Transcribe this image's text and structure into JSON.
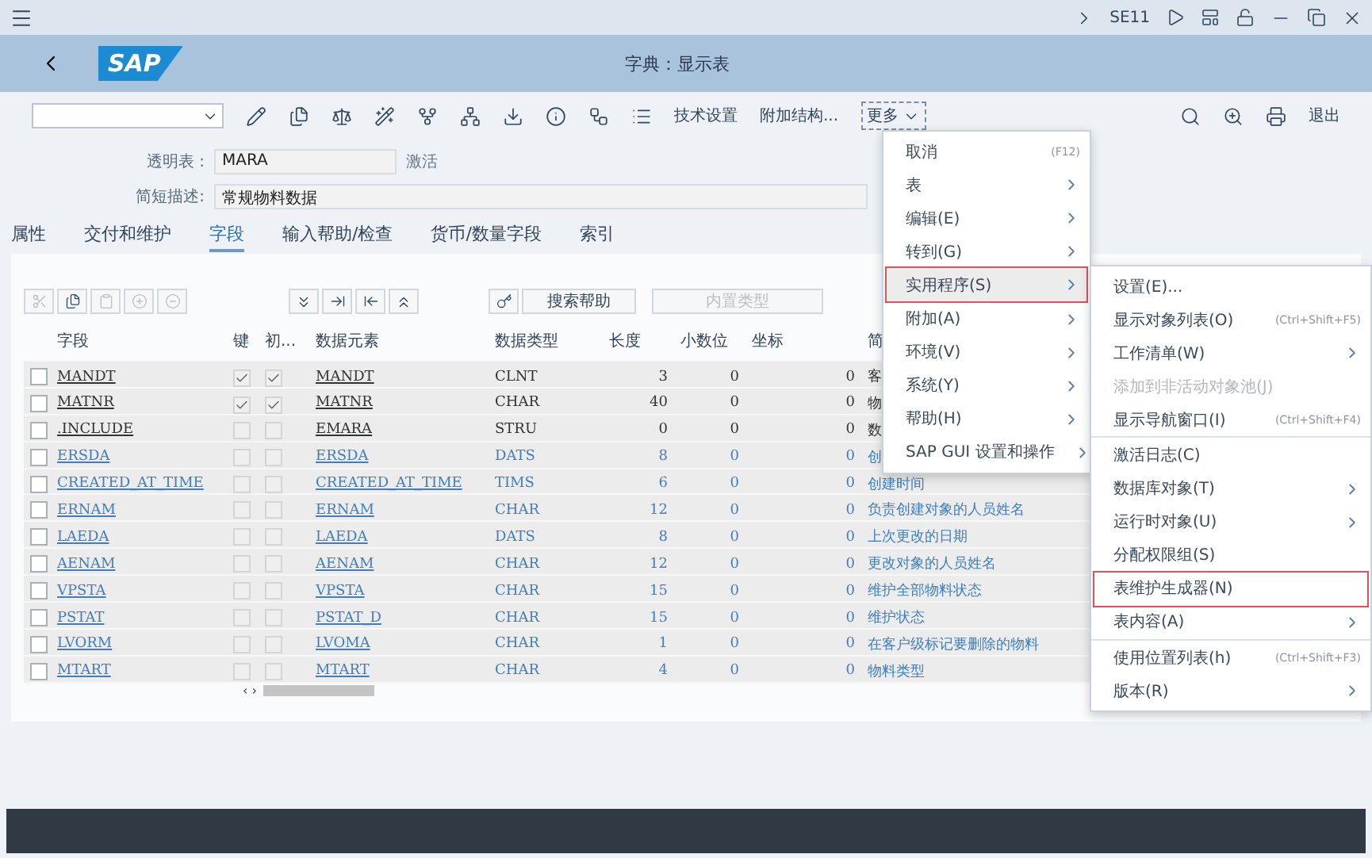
{
  "top_bar": {
    "transaction": "SE11"
  },
  "header": {
    "logo": "SAP",
    "title": "字典：显示表"
  },
  "toolbar": {
    "buttons": [
      "技术设置",
      "附加结构..."
    ],
    "more": "更多",
    "exit": "退出"
  },
  "form": {
    "table_label": "透明表 :",
    "table_value": "MARA",
    "status": "激活",
    "desc_label": "简短描述:",
    "desc_value": "常规物料数据"
  },
  "tabs": [
    {
      "label": "属性",
      "selected": false
    },
    {
      "label": "交付和维护",
      "selected": false
    },
    {
      "label": "字段",
      "selected": true
    },
    {
      "label": "输入帮助/检查",
      "selected": false
    },
    {
      "label": "货币/数量字段",
      "selected": false
    },
    {
      "label": "索引",
      "selected": false
    }
  ],
  "table_toolbar": {
    "search_help": "搜索帮助",
    "builtin_type": "内置类型"
  },
  "table": {
    "scroll_arrows": "‹ ›",
    "columns": [
      "字段",
      "键",
      "初...",
      "数据元素",
      "数据类型",
      "长度",
      "小数位",
      "坐标",
      "简"
    ],
    "rows": [
      {
        "kind": "plain",
        "checked": false,
        "field": "MANDT",
        "key": true,
        "initial": true,
        "data_element": "MANDT",
        "data_type": "CLNT",
        "length": "3",
        "decimals": "0",
        "coordinate": "0",
        "description": "客"
      },
      {
        "kind": "plain",
        "checked": false,
        "field": "MATNR",
        "key": true,
        "initial": true,
        "data_element": "MATNR",
        "data_type": "CHAR",
        "length": "40",
        "decimals": "0",
        "coordinate": "0",
        "description": "物"
      },
      {
        "kind": "plain",
        "checked": false,
        "field": ".INCLUDE",
        "key": false,
        "initial": false,
        "data_element": "EMARA",
        "data_type": "STRU",
        "length": "0",
        "decimals": "0",
        "coordinate": "0",
        "description": "数"
      },
      {
        "kind": "link",
        "checked": false,
        "field": "ERSDA",
        "key": false,
        "initial": false,
        "data_element": "ERSDA",
        "data_type": "DATS",
        "length": "8",
        "decimals": "0",
        "coordinate": "0",
        "description": "创"
      },
      {
        "kind": "link",
        "checked": false,
        "field": "CREATED_AT_TIME",
        "key": false,
        "initial": false,
        "data_element": "CREATED_AT_TIME",
        "data_type": "TIMS",
        "length": "6",
        "decimals": "0",
        "coordinate": "0",
        "description": "创建时间"
      },
      {
        "kind": "link",
        "checked": false,
        "field": "ERNAM",
        "key": false,
        "initial": false,
        "data_element": "ERNAM",
        "data_type": "CHAR",
        "length": "12",
        "decimals": "0",
        "coordinate": "0",
        "description": "负责创建对象的人员姓名"
      },
      {
        "kind": "link",
        "checked": false,
        "field": "LAEDA",
        "key": false,
        "initial": false,
        "data_element": "LAEDA",
        "data_type": "DATS",
        "length": "8",
        "decimals": "0",
        "coordinate": "0",
        "description": "上次更改的日期"
      },
      {
        "kind": "link",
        "checked": false,
        "field": "AENAM",
        "key": false,
        "initial": false,
        "data_element": "AENAM",
        "data_type": "CHAR",
        "length": "12",
        "decimals": "0",
        "coordinate": "0",
        "description": "更改对象的人员姓名"
      },
      {
        "kind": "link",
        "checked": false,
        "field": "VPSTA",
        "key": false,
        "initial": false,
        "data_element": "VPSTA",
        "data_type": "CHAR",
        "length": "15",
        "decimals": "0",
        "coordinate": "0",
        "description": "维护全部物料状态"
      },
      {
        "kind": "link",
        "checked": false,
        "field": "PSTAT",
        "key": false,
        "initial": false,
        "data_element": "PSTAT_D",
        "data_type": "CHAR",
        "length": "15",
        "decimals": "0",
        "coordinate": "0",
        "description": "维护状态"
      },
      {
        "kind": "link",
        "checked": false,
        "field": "LVORM",
        "key": false,
        "initial": false,
        "data_element": "LVOMA",
        "data_type": "CHAR",
        "length": "1",
        "decimals": "0",
        "coordinate": "0",
        "description": "在客户级标记要删除的物料"
      },
      {
        "kind": "link",
        "checked": false,
        "field": "MTART",
        "key": false,
        "initial": false,
        "data_element": "MTART",
        "data_type": "CHAR",
        "length": "4",
        "decimals": "0",
        "coordinate": "0",
        "description": "物料类型"
      }
    ]
  },
  "menu": {
    "groups": [
      [
        {
          "label": "取消",
          "shortcut": "(F12)",
          "submenu": false,
          "disabled": false,
          "selected": false,
          "highlighted": false
        },
        {
          "label": "表",
          "submenu": true,
          "disabled": false,
          "selected": false,
          "highlighted": false
        },
        {
          "label": "编辑(E)",
          "submenu": true,
          "disabled": false,
          "selected": false,
          "highlighted": false
        },
        {
          "label": "转到(G)",
          "submenu": true,
          "disabled": false,
          "selected": false,
          "highlighted": false
        },
        {
          "label": "实用程序(S)",
          "submenu": true,
          "disabled": false,
          "selected": true,
          "highlighted": true
        },
        {
          "label": "附加(A)",
          "submenu": true,
          "disabled": false,
          "selected": false,
          "highlighted": false
        },
        {
          "label": "环境(V)",
          "submenu": true,
          "disabled": false,
          "selected": false,
          "highlighted": false
        },
        {
          "label": "系统(Y)",
          "submenu": true,
          "disabled": false,
          "selected": false,
          "highlighted": false
        },
        {
          "label": "帮助(H)",
          "submenu": true,
          "disabled": false,
          "selected": false,
          "highlighted": false
        },
        {
          "label": "SAP GUI 设置和操作",
          "submenu": true,
          "disabled": false,
          "selected": false,
          "highlighted": false
        }
      ]
    ]
  },
  "submenu": {
    "groups": [
      [
        {
          "label": "设置(E)...",
          "submenu": false,
          "disabled": false,
          "selected": false,
          "highlighted": false
        },
        {
          "label": "显示对象列表(O)",
          "shortcut": "(Ctrl+Shift+F5)",
          "submenu": false,
          "disabled": false,
          "selected": false,
          "highlighted": false
        },
        {
          "label": "工作清单(W)",
          "submenu": true,
          "disabled": false,
          "selected": false,
          "highlighted": false
        },
        {
          "label": "添加到非活动对象池(J)",
          "submenu": false,
          "disabled": true,
          "selected": false,
          "highlighted": false
        },
        {
          "label": "显示导航窗口(I)",
          "shortcut": "(Ctrl+Shift+F4)",
          "submenu": false,
          "disabled": false,
          "selected": false,
          "highlighted": false
        }
      ],
      [
        {
          "label": "激活日志(C)",
          "submenu": false,
          "disabled": false,
          "selected": false,
          "highlighted": false
        },
        {
          "label": "数据库对象(T)",
          "submenu": true,
          "disabled": false,
          "selected": false,
          "highlighted": false
        },
        {
          "label": "运行时对象(U)",
          "submenu": true,
          "disabled": false,
          "selected": false,
          "highlighted": false
        },
        {
          "label": "分配权限组(S)",
          "submenu": false,
          "disabled": false,
          "selected": false,
          "highlighted": false
        },
        {
          "label": "表维护生成器(N)",
          "submenu": false,
          "disabled": false,
          "selected": false,
          "highlighted": true
        },
        {
          "label": "表内容(A)",
          "submenu": true,
          "disabled": false,
          "selected": false,
          "highlighted": false
        }
      ],
      [
        {
          "label": "使用位置列表(h)",
          "shortcut": "(Ctrl+Shift+F3)",
          "submenu": false,
          "disabled": false,
          "selected": false,
          "highlighted": false
        },
        {
          "label": "版本(R)",
          "submenu": true,
          "disabled": false,
          "selected": false,
          "highlighted": false
        }
      ]
    ]
  }
}
